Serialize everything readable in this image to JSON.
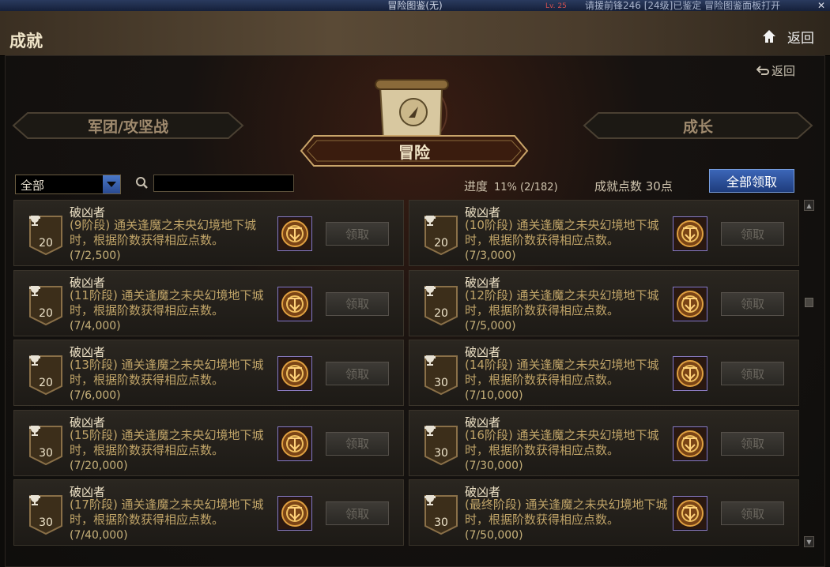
{
  "window": {
    "title": "冒险图鉴(无)",
    "ticker": "请援前锋246 [24级]已鉴定 冒险图鉴面板打开",
    "level_tag": "Lv. 25"
  },
  "header": {
    "title": "成就",
    "back_label": "返回"
  },
  "main": {
    "back_label": "返回",
    "categories": {
      "left": "军团/攻坚战",
      "center": "冒险",
      "right": "成长"
    },
    "filter": {
      "selected": "全部"
    },
    "search": {
      "placeholder": "",
      "value": ""
    },
    "progress_label": "进度",
    "progress_value": "11% (2/182)",
    "progress_fraction": 0.11,
    "points_label": "成就点数 30点",
    "claim_all_label": "全部领取"
  },
  "achievements": [
    {
      "name": "破凶者",
      "desc": "(9阶段) 通关逢魔之未央幻境地下城时，根据阶数获得相应点数。",
      "progress": "(7/2,500)",
      "points": "20",
      "claim": "领取"
    },
    {
      "name": "破凶者",
      "desc": "(10阶段) 通关逢魔之未央幻境地下城时，根据阶数获得相应点数。",
      "progress": "(7/3,000)",
      "points": "20",
      "claim": "领取"
    },
    {
      "name": "破凶者",
      "desc": "(11阶段) 通关逢魔之未央幻境地下城时，根据阶数获得相应点数。",
      "progress": "(7/4,000)",
      "points": "20",
      "claim": "领取"
    },
    {
      "name": "破凶者",
      "desc": "(12阶段) 通关逢魔之未央幻境地下城时，根据阶数获得相应点数。",
      "progress": "(7/5,000)",
      "points": "20",
      "claim": "领取"
    },
    {
      "name": "破凶者",
      "desc": "(13阶段) 通关逢魔之未央幻境地下城时，根据阶数获得相应点数。",
      "progress": "(7/6,000)",
      "points": "20",
      "claim": "领取"
    },
    {
      "name": "破凶者",
      "desc": "(14阶段) 通关逢魔之未央幻境地下城时，根据阶数获得相应点数。",
      "progress": "(7/10,000)",
      "points": "30",
      "claim": "领取"
    },
    {
      "name": "破凶者",
      "desc": "(15阶段) 通关逢魔之未央幻境地下城时，根据阶数获得相应点数。",
      "progress": "(7/20,000)",
      "points": "30",
      "claim": "领取"
    },
    {
      "name": "破凶者",
      "desc": "(16阶段) 通关逢魔之未央幻境地下城时，根据阶数获得相应点数。",
      "progress": "(7/30,000)",
      "points": "30",
      "claim": "领取"
    },
    {
      "name": "破凶者",
      "desc": "(17阶段) 通关逢魔之未央幻境地下城时，根据阶数获得相应点数。",
      "progress": "(7/40,000)",
      "points": "30",
      "claim": "领取"
    },
    {
      "name": "破凶者",
      "desc": "(最终阶段) 通关逢魔之未央幻境地下城时，根据阶数获得相应点数。",
      "progress": "(7/50,000)",
      "points": "30",
      "claim": "领取"
    }
  ],
  "colors": {
    "accent_blue": "#2a4a90",
    "gold_text": "#c0a468",
    "reward_border": "#8a7ac0"
  }
}
